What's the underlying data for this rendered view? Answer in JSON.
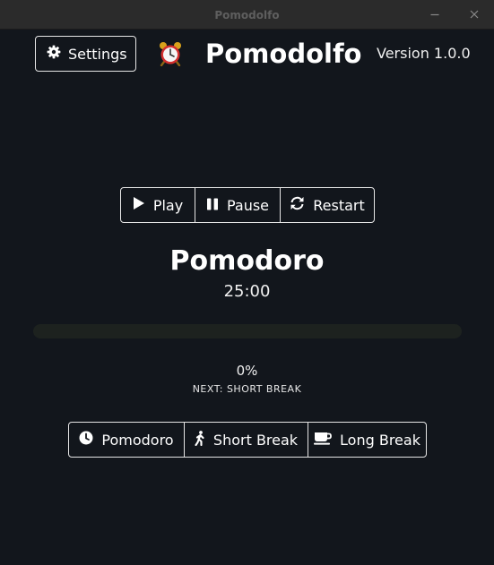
{
  "window": {
    "title": "Pomodolfo",
    "controls": [
      {
        "name": "minimize-icon"
      },
      {
        "name": "close-icon"
      }
    ]
  },
  "header": {
    "settings_label": "Settings",
    "settings_icon": "gear-icon",
    "logo_icon": "alarm-clock-icon",
    "app_title": "Pomodolfo",
    "version": "Version 1.0.0"
  },
  "controls": {
    "play_label": "Play",
    "pause_label": "Pause",
    "restart_label": "Restart"
  },
  "timer": {
    "mode": "Pomodoro",
    "time": "25:00",
    "progress_percent": 0,
    "progress_label": "0%",
    "next_label": "NEXT: SHORT BREAK"
  },
  "modes": {
    "pomodoro_label": "Pomodoro",
    "short_break_label": "Short Break",
    "long_break_label": "Long Break"
  },
  "colors": {
    "background": "#12161c",
    "titlebar": "#2b2b2b",
    "text": "#ffffff",
    "border": "#e6e6e6",
    "progress_track": "#1d221f"
  }
}
